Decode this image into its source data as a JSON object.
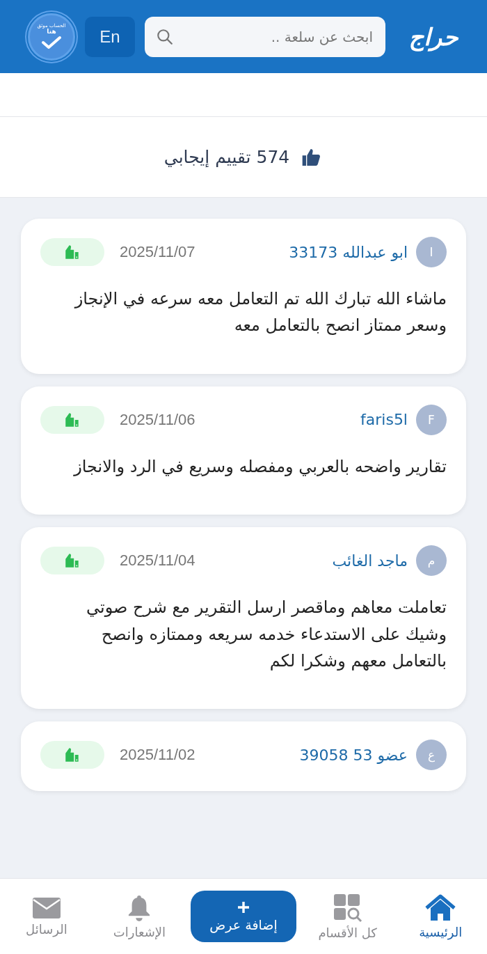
{
  "header": {
    "logo": "حراج",
    "search": {
      "placeholder": "ابحث عن سلعة .."
    },
    "language_button": "En",
    "verified_badge": [
      "الحساب موثق",
      "هنا"
    ]
  },
  "rating_summary": {
    "count": "574",
    "label": "تقييم إيجابي"
  },
  "reviews": [
    {
      "avatar": "I",
      "name": "ابو عبدالله 33173",
      "date": "2025/11/07",
      "text": "ماشاء الله تبارك الله تم التعامل معه سرعه في الإنجاز وسعر ممتاز انصح بالتعامل معه"
    },
    {
      "avatar": "F",
      "name": "faris5l",
      "date": "2025/11/06",
      "text": "تقارير واضحه بالعربي ومفصله وسريع في الرد والانجاز"
    },
    {
      "avatar": "م",
      "name": "ماجد الغائب",
      "date": "2025/11/04",
      "text": "تعاملت معاهم وماقصر ارسل التقرير مع شرح صوتي وشيك على الاستدعاء خدمه سريعه وممتازه وانصح بالتعامل معهم وشكرا لكم"
    },
    {
      "avatar": "ع",
      "name": "عضو 53 39058",
      "date": "2025/11/02"
    }
  ],
  "bottom_nav": [
    {
      "kind": "home",
      "label": "الرئيسية",
      "selected": true
    },
    {
      "kind": "categories",
      "label": "كل الأقسام",
      "selected": false
    },
    {
      "kind": "add",
      "label": "إضافة عرض",
      "selected": false
    },
    {
      "kind": "notifications",
      "label": "الإشعارات",
      "selected": false
    },
    {
      "kind": "messages",
      "label": "الرسائل",
      "selected": false
    }
  ]
}
